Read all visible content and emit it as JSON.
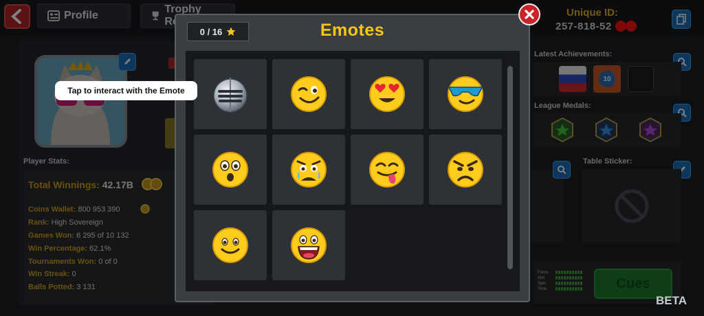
{
  "header": {
    "tabs": [
      {
        "label": "Profile",
        "icon": "profile-card-icon"
      },
      {
        "label": "Trophy Road",
        "icon": "trophy-icon"
      }
    ],
    "unique_id_label": "Unique ID:",
    "unique_id_value": "257-818-52"
  },
  "left": {
    "player_stats_label": "Player Stats:",
    "total_winnings_label": "Total Winnings:",
    "total_winnings_value": "42.17B",
    "stats": [
      {
        "key": "Coins Wallet:",
        "value": "800 953 390"
      },
      {
        "key": "Rank:",
        "value": "High Sovereign"
      },
      {
        "key": "Games Won:",
        "value": "6 295 of 10 132"
      },
      {
        "key": "Win Percentage:",
        "value": "62.1%"
      },
      {
        "key": "Tournaments Won:",
        "value": "0 of 0"
      },
      {
        "key": "Win Streak:",
        "value": "0"
      },
      {
        "key": "Balls Potted:",
        "value": "3 131"
      }
    ]
  },
  "right": {
    "latest_achievements_label": "Latest Achievements:",
    "league_medals_label": "League Medals:",
    "table_sticker_label": "Table Sticker:",
    "achievement_badge_number": "10",
    "meter_labels": [
      "Force",
      "Aim",
      "Spin",
      "Time"
    ],
    "cues_label": "Cues",
    "beta_label": "BETA"
  },
  "modal": {
    "title": "Emotes",
    "counter": "0 / 16",
    "tooltip": "Tap to interact with the Emote",
    "emotes": [
      {
        "name": "knight-helmet"
      },
      {
        "name": "winking-face"
      },
      {
        "name": "heart-eyes-face"
      },
      {
        "name": "sunglasses-face"
      },
      {
        "name": "surprised-face"
      },
      {
        "name": "crying-face"
      },
      {
        "name": "tongue-out-face"
      },
      {
        "name": "angry-face"
      },
      {
        "name": "smiling-face"
      },
      {
        "name": "laughing-face"
      }
    ]
  },
  "colors": {
    "title_gold": "#f5c613",
    "emoji_yellow": "#ffcc1d",
    "close_red": "#c8242a",
    "cues_green": "#1f7a2a"
  }
}
